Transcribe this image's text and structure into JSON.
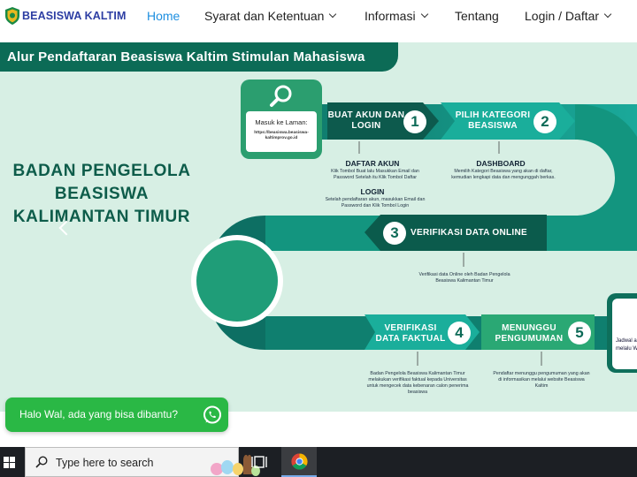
{
  "brand": {
    "name": "BEASISWA KALTIM"
  },
  "nav": {
    "items": [
      {
        "label": "Home",
        "active": true,
        "dropdown": false
      },
      {
        "label": "Syarat dan Ketentuan",
        "active": false,
        "dropdown": true
      },
      {
        "label": "Informasi",
        "active": false,
        "dropdown": true
      },
      {
        "label": "Tentang",
        "active": false,
        "dropdown": false
      },
      {
        "label": "Login / Daftar",
        "active": false,
        "dropdown": true
      }
    ]
  },
  "banner": {
    "title": "Alur Pendaftaran Beasiswa Kaltim Stimulan Mahasiswa",
    "org_name": "BADAN PENGELOLA BEASISWA KALIMANTAN TIMUR",
    "masuk_label": "Masuk ke Laman:",
    "masuk_url": "https://beasiswa.beasiswa-kaltimprov.go.id",
    "steps": [
      {
        "number": "1",
        "label": "BUAT AKUN DAN LOGIN"
      },
      {
        "number": "2",
        "label": "PILIH KATEGORI BEASISWA"
      },
      {
        "number": "3",
        "label": "VERIFIKASI DATA ONLINE"
      },
      {
        "number": "4",
        "label": "VERIFIKASI DATA FAKTUAL"
      },
      {
        "number": "5",
        "label": "MENUNGGU PENGUMUMAN"
      }
    ],
    "notes": {
      "daftar_head": "DAFTAR AKUN",
      "daftar_text": "Klik Tombol Buat lalu Masukkan Email dan Password Setelah itu Klik Tombol Daftar",
      "login_head": "LOGIN",
      "login_text": "Setelah pendaftaran akun, masukkan Email dan Password dan Klik Tombol Login",
      "dashboard_head": "DASHBOARD",
      "dashboard_text": "Memilih Kategori Beasiswa yang akan di daftar, kemudian lengkapi data dan mengunggah berkas.",
      "verif_online_text": "Verifikasi data Online oleh Badan Pengelola Beasiswa Kalimantan Timur",
      "verif_faktual_text": "Badan Pengelola Beasiswa Kalimantan Timur melakukan verifikasi faktual kepada Universitas untuk mengecek data kebenaran calon penerima beasiswa",
      "pengumuman_text": "Pendaftar menunggu pengumuman yang akan di informasikan melalui website Beasiswa Kaltim",
      "jadwal_text": "Jadwal aan d melalu Webs"
    }
  },
  "whatsapp": {
    "message": "Halo Wal, ada yang bisa dibantu?"
  },
  "taskbar": {
    "search_placeholder": "Type here to search"
  },
  "colors": {
    "brand_blue": "#2d3ea3",
    "nav_active": "#1e8fe0",
    "dark_green": "#0c6b56",
    "teal": "#16a394",
    "banner_bg": "#d7efe4",
    "whatsapp_green": "#2ab845",
    "taskbar": "#1c1f24"
  }
}
